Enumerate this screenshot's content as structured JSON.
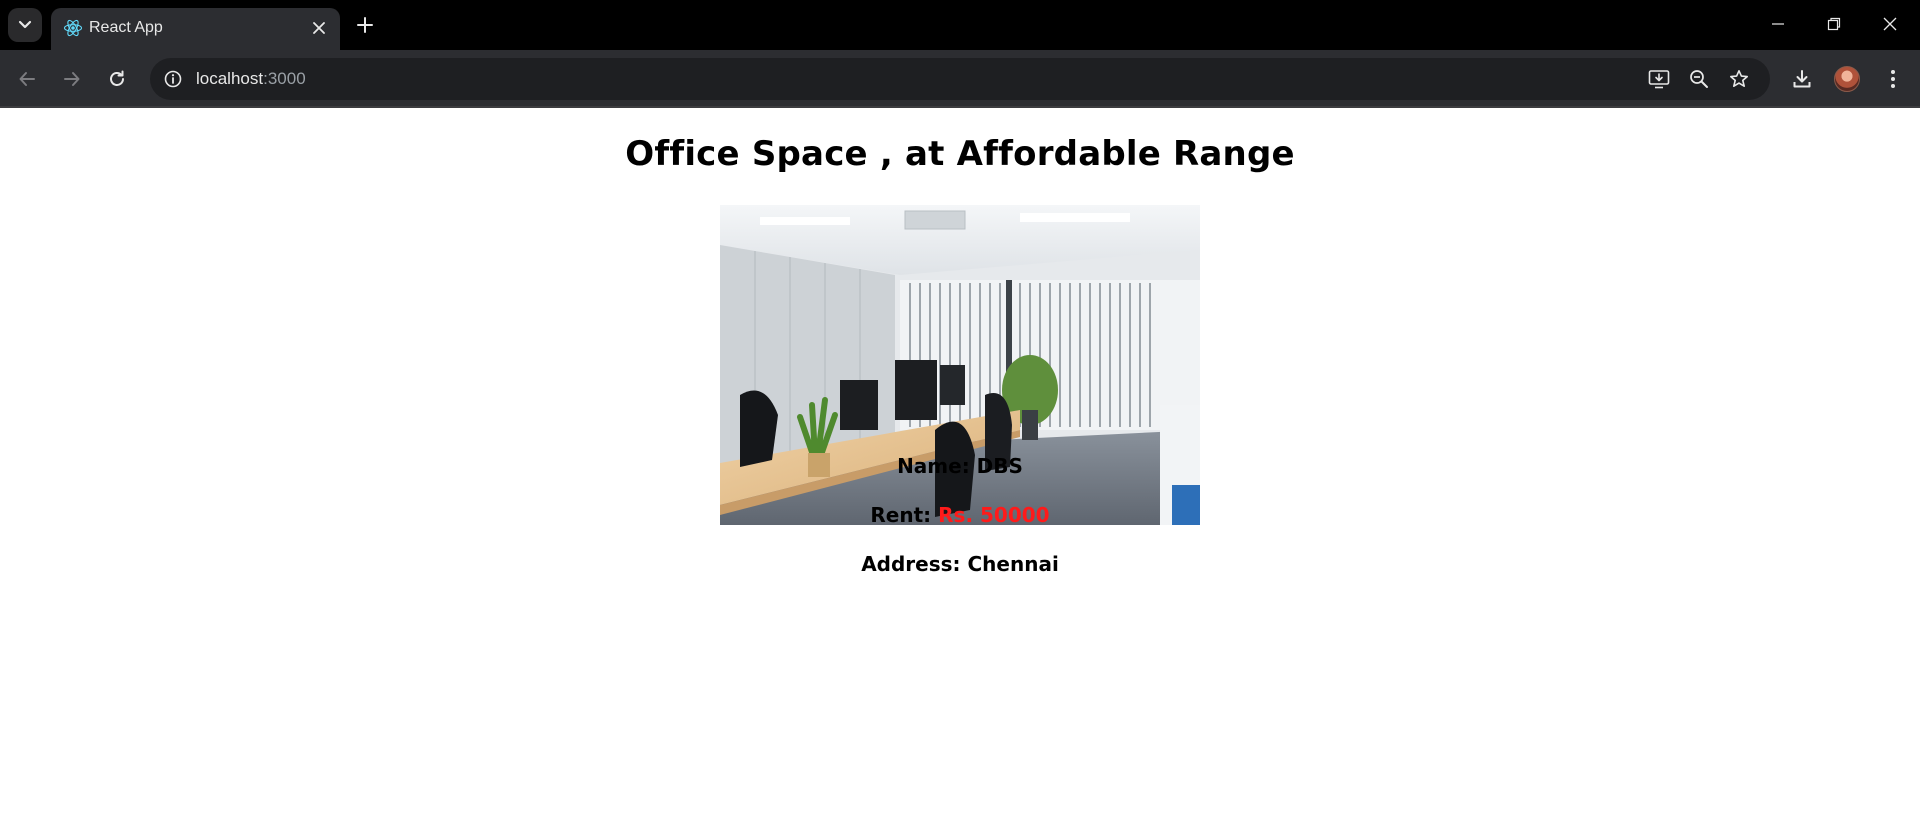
{
  "browser": {
    "tab_title": "React App",
    "url_host": "localhost",
    "url_port": ":3000",
    "icons": {
      "tab_search": "chevron-down-icon",
      "favicon": "react-logo-icon",
      "tab_close": "close-icon",
      "new_tab": "plus-icon",
      "minimize": "minimize-icon",
      "restore": "restore-icon",
      "close_window": "close-icon",
      "back": "arrow-left-icon",
      "forward": "arrow-right-icon",
      "reload": "reload-icon",
      "site_info": "info-icon",
      "install_app": "install-icon",
      "zoom": "zoom-out-icon",
      "bookmark": "star-icon",
      "downloads": "download-icon",
      "profile": "avatar-icon",
      "menu": "more-vert-icon"
    }
  },
  "page": {
    "heading": "Office Space , at Affordable Range",
    "image_alt": "office-photo",
    "name_label": "Name: ",
    "name_value": "DBS",
    "rent_label": "Rent: ",
    "rent_value": "Rs. 50000",
    "address_label": "Address: ",
    "address_value": "Chennai"
  },
  "colors": {
    "rent_value": "#ff1a1a",
    "browser_frame": "#000000",
    "toolbar": "#2c2d31"
  }
}
